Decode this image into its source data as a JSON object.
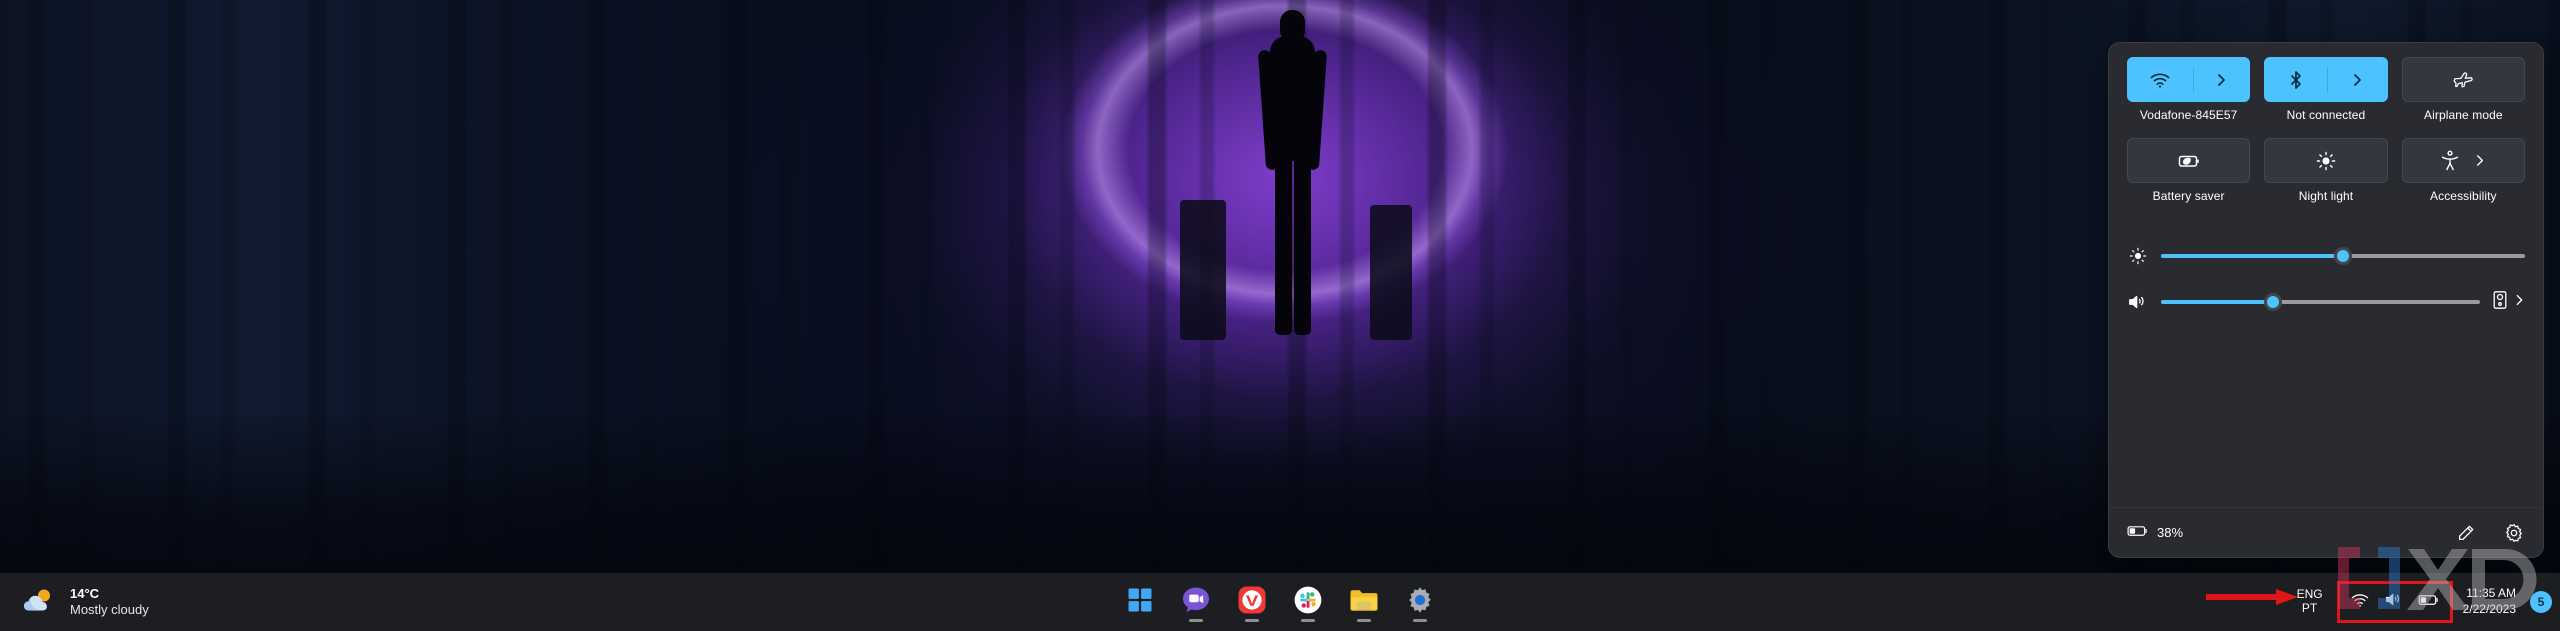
{
  "desktop": {
    "wallpaper_description": "Dark forest at night with a silhouetted figure standing inside a glowing purple ring",
    "accent_color": "#4cc2ff",
    "panel_bg_color": "#2a2b30",
    "taskbar_bg_color": "#1d1e22"
  },
  "quick_settings": {
    "tiles": [
      {
        "id": "wifi",
        "label": "Vodafone-845E57",
        "icon": "wifi-icon",
        "state": "on",
        "has_chevron": true
      },
      {
        "id": "bluetooth",
        "label": "Not connected",
        "icon": "bluetooth-icon",
        "state": "on",
        "has_chevron": true
      },
      {
        "id": "airplane",
        "label": "Airplane mode",
        "icon": "airplane-icon",
        "state": "off",
        "has_chevron": false
      },
      {
        "id": "battery-saver",
        "label": "Battery saver",
        "icon": "battery-saver-icon",
        "state": "off",
        "has_chevron": false
      },
      {
        "id": "night-light",
        "label": "Night light",
        "icon": "night-light-icon",
        "state": "off",
        "has_chevron": false
      },
      {
        "id": "accessibility",
        "label": "Accessibility",
        "icon": "accessibility-icon",
        "state": "off",
        "has_chevron": true
      }
    ],
    "sliders": [
      {
        "id": "brightness",
        "icon": "brightness-icon",
        "value": 50,
        "min": 0,
        "max": 100,
        "has_trailing_control": false
      },
      {
        "id": "volume",
        "icon": "volume-icon",
        "value": 35,
        "min": 0,
        "max": 100,
        "has_trailing_control": true,
        "trailing_icon": "audio-output-icon"
      }
    ],
    "footer": {
      "battery_icon": "battery-icon",
      "battery_percent": "38%",
      "edit_icon": "pencil-icon",
      "settings_icon": "gear-icon"
    }
  },
  "taskbar": {
    "weather": {
      "icon": "sun-behind-cloud-icon",
      "temperature": "14°C",
      "condition": "Mostly cloudy"
    },
    "apps": [
      {
        "id": "start",
        "name": "Start",
        "icon": "windows-logo-icon",
        "running": false
      },
      {
        "id": "chat",
        "name": "Chat",
        "icon": "chat-video-icon",
        "running": true
      },
      {
        "id": "vivaldi",
        "name": "Vivaldi",
        "icon": "vivaldi-icon",
        "running": true
      },
      {
        "id": "slack",
        "name": "Slack",
        "icon": "slack-icon",
        "running": true
      },
      {
        "id": "file-explorer",
        "name": "File Explorer",
        "icon": "folder-icon",
        "running": true
      },
      {
        "id": "settings",
        "name": "Settings",
        "icon": "settings-gear-icon",
        "running": true
      }
    ],
    "tray": {
      "language": {
        "line1": "ENG",
        "line2": "PT"
      },
      "icons": [
        "wifi-icon",
        "volume-icon",
        "battery-icon"
      ],
      "time": "11:35 AM",
      "date": "2/22/2023",
      "notification_count": "5"
    }
  },
  "annotations": {
    "highlight_color": "#e01616",
    "arrow": "red-arrow-pointing-right-at-tray-icons",
    "highlight_box": "red-rectangle-around-tray-icons"
  },
  "watermark": {
    "text": "XDA"
  }
}
